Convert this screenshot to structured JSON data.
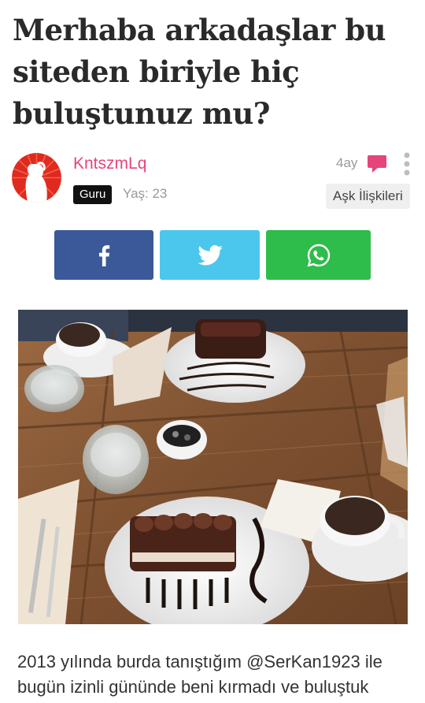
{
  "post": {
    "title": "Merhaba arkadaşlar bu siteden biriyle hiç buluştunuz mu?",
    "body": "2013 yılında burda tanıştığım @SerKan1923 ile bugün izinli gününde beni kırmadı ve buluştuk"
  },
  "author": {
    "username": "KntszmLq",
    "badge": "Guru",
    "age_text": "Yaş: 23"
  },
  "meta": {
    "time_ago": "4ay",
    "category": "Aşk İlişkileri"
  },
  "share": {
    "facebook_icon": "facebook-icon",
    "twitter_icon": "twitter-icon",
    "whatsapp_icon": "whatsapp-icon"
  },
  "colors": {
    "username": "#e5457a",
    "facebook": "#3b5998",
    "twitter": "#4bc7ee",
    "whatsapp": "#2ebc4a",
    "comment_icon": "#e5457a"
  }
}
